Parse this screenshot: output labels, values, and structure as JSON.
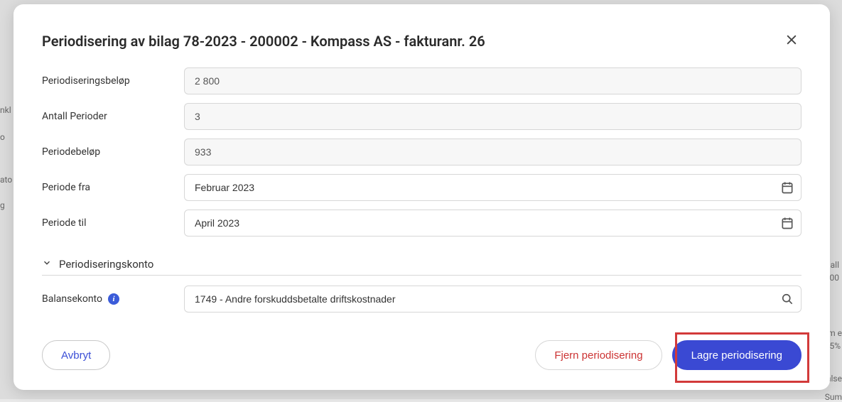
{
  "modal": {
    "title": "Periodisering av bilag 78-2023 - 200002 - Kompass AS - fakturanr. 26"
  },
  "form": {
    "amount_label": "Periodiseringsbeløp",
    "amount_value": "2 800",
    "periods_label": "Antall Perioder",
    "periods_value": "3",
    "period_amount_label": "Periodebeløp",
    "period_amount_value": "933",
    "from_label": "Periode fra",
    "from_value": "Februar 2023",
    "to_label": "Periode til",
    "to_value": "April 2023"
  },
  "section": {
    "account_header": "Periodiseringskonto",
    "balance_label": "Balansekonto",
    "balance_value": "1749 - Andre forskuddsbetalte driftskostnader"
  },
  "buttons": {
    "cancel": "Avbryt",
    "remove": "Fjern periodisering",
    "save": "Lagre periodisering"
  },
  "background_fragments": {
    "f1": "nkl",
    "f2": "o",
    "f3": "ato",
    "f4": "g",
    "f5": "all",
    "f6": "00",
    "f7": "m e",
    "f8": "5%",
    "f9": "alse",
    "f10": "Sum"
  }
}
